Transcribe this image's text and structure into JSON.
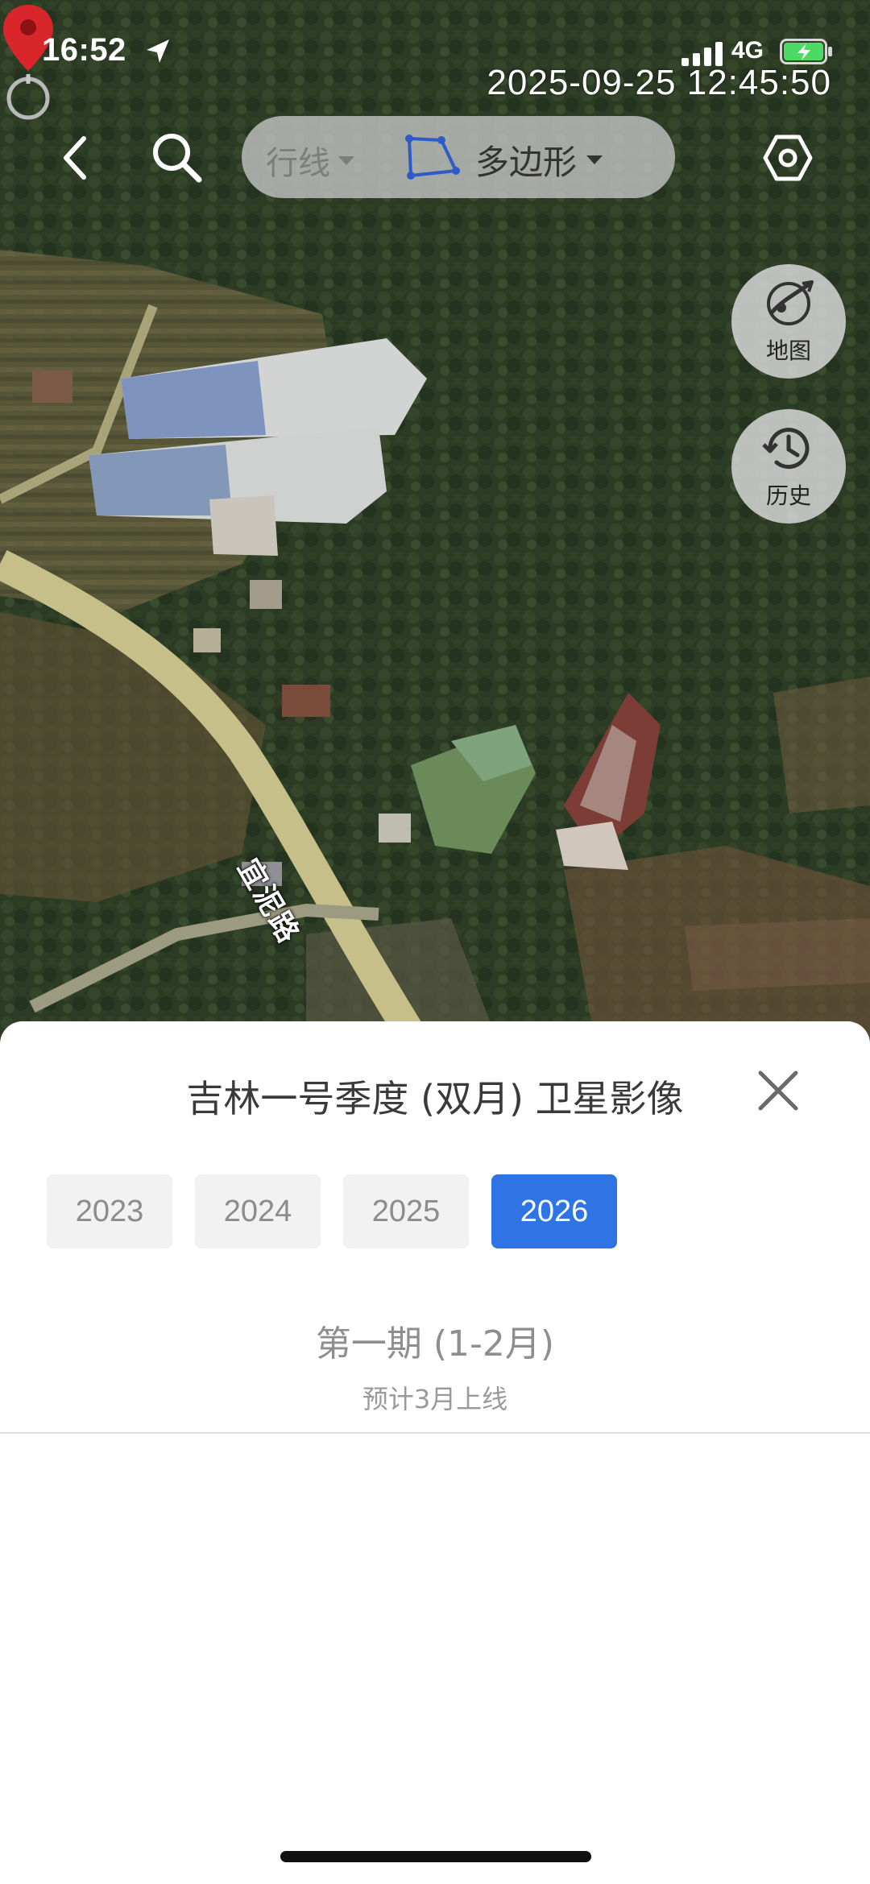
{
  "status_bar": {
    "time": "16:52",
    "network": "4G",
    "capture_timestamp": "2025-09-25 12:45:50"
  },
  "toolbar": {
    "back_icon": "chevron-left-icon",
    "search_icon": "search-icon",
    "settings_icon": "hexagon-settings-icon",
    "draw_modes": {
      "previous_label": "行线",
      "current_label": "多边形",
      "current_icon": "polygon-icon"
    }
  },
  "map": {
    "road_label": "宜泥路",
    "marker_icon": "location-pin-icon",
    "accent_color": "#d9262a"
  },
  "floating_buttons": {
    "map": {
      "label": "地图",
      "icon": "map-layers-icon"
    },
    "history": {
      "label": "历史",
      "icon": "history-clock-icon"
    }
  },
  "sheet": {
    "title": "吉林一号季度 (双月) 卫星影像",
    "close_icon": "close-icon",
    "years": [
      "2023",
      "2024",
      "2025",
      "2026"
    ],
    "selected_year": "2026",
    "selected_color": "#2f74e5",
    "period": {
      "title": "第一期 (1-2月)",
      "subtitle": "预计3月上线"
    }
  }
}
